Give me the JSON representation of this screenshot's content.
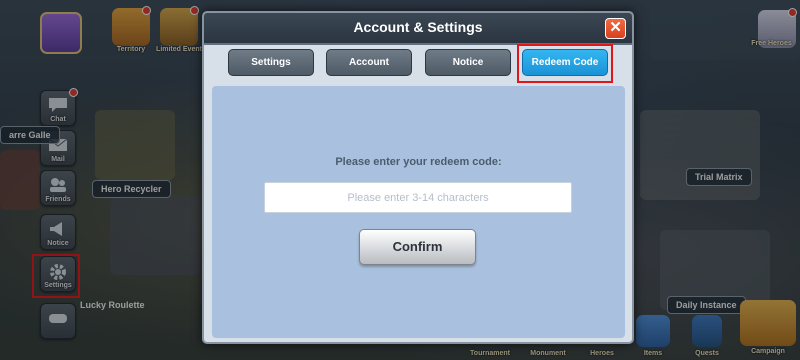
{
  "dialog": {
    "title": "Account & Settings",
    "close_glyph": "✕",
    "tabs": [
      {
        "label": "Settings",
        "active": false
      },
      {
        "label": "Account",
        "active": false
      },
      {
        "label": "Notice",
        "active": false
      },
      {
        "label": "Redeem Code",
        "active": true
      }
    ],
    "prompt": "Please enter your redeem code:",
    "input_placeholder": "Please enter 3-14 characters",
    "input_value": "",
    "confirm_label": "Confirm"
  },
  "background": {
    "top_icons": [
      "Territory",
      "Limited Event"
    ],
    "sidebar": [
      "Chat",
      "Mail",
      "Friends",
      "Notice",
      "Settings"
    ],
    "sidebar_icons": [
      "chat-icon",
      "mail-icon",
      "friends-icon",
      "notice-icon",
      "gear-icon",
      "gamepad-icon"
    ],
    "map_labels": {
      "gallery": "arre Galle",
      "recycler": "Hero Recycler",
      "trial": "Trial Matrix",
      "daily": "Daily Instance",
      "roulette": "Lucky Roulette",
      "free_heroes": "Free Heroes"
    },
    "bottom_nav": [
      "Tournament",
      "Monument",
      "Heroes",
      "Items",
      "Quests",
      "Campaign"
    ]
  },
  "highlight_color": "#e2151b",
  "accent_color": "#1a93d6"
}
